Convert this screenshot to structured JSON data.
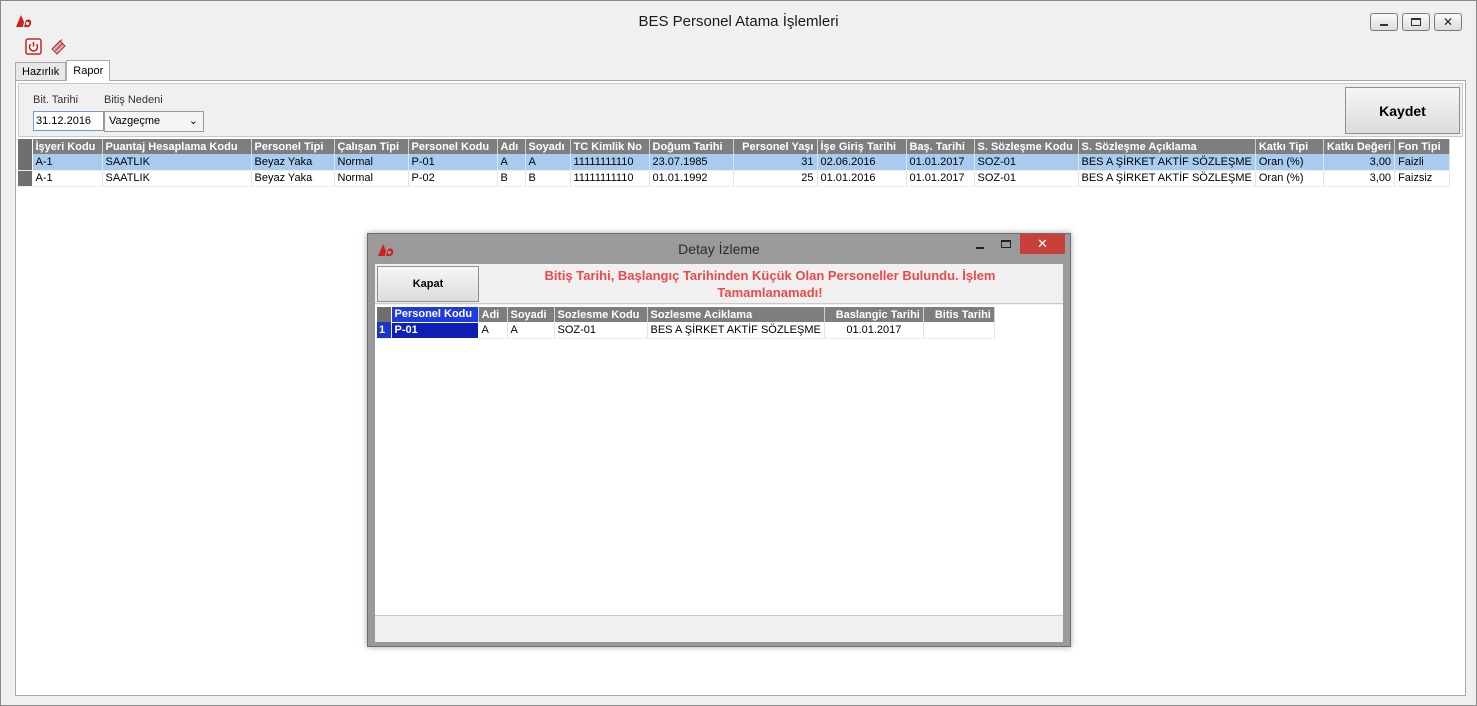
{
  "window": {
    "title": "BES Personel Atama İşlemleri"
  },
  "tabs": [
    {
      "label": "Hazırlık",
      "active": false
    },
    {
      "label": "Rapor",
      "active": true
    }
  ],
  "filters": {
    "end_date_label": "Bit. Tarihi",
    "end_date_value": "31.12.2016",
    "reason_label": "Bitiş Nedeni",
    "reason_value": "Vazgeçme"
  },
  "save_label": "Kaydet",
  "main_grid": {
    "columns": [
      "İşyeri Kodu",
      "Puantaj Hesaplama Kodu",
      "Personel Tipi",
      "Çalışan Tipi",
      "Personel Kodu",
      "Adı",
      "Soyadı",
      "TC Kimlik No",
      "Doğum Tarihi",
      "Personel Yaşı",
      "İşe Giriş Tarihi",
      "Baş. Tarihi",
      "S. Sözleşme Kodu",
      "S. Sözleşme Açıklama",
      "Katkı Tipi",
      "Katkı Değeri",
      "Fon Tipi"
    ],
    "rows": [
      [
        "A-1",
        "SAATLIK",
        "Beyaz Yaka",
        "Normal",
        "P-01",
        "A",
        "A",
        "11111111110",
        "23.07.1985",
        "31",
        "02.06.2016",
        "01.01.2017",
        "SOZ-01",
        "BES A ŞİRKET AKTİF SÖZLEŞME",
        "Oran (%)",
        "3,00",
        "Faizli"
      ],
      [
        "A-1",
        "SAATLIK",
        "Beyaz Yaka",
        "Normal",
        "P-02",
        "B",
        "B",
        "11111111110",
        "01.01.1992",
        "25",
        "01.01.2016",
        "01.01.2017",
        "SOZ-01",
        "BES A ŞİRKET AKTİF SÖZLEŞME",
        "Oran (%)",
        "3,00",
        "Faizsiz"
      ]
    ]
  },
  "dialog": {
    "title": "Detay İzleme",
    "close_label": "Kapat",
    "message": "Bitiş Tarihi, Başlangıç Tarihinden Küçük Olan Personeller Bulundu. İşlem Tamamlanamadı!",
    "columns": [
      "Personel Kodu",
      "Adi",
      "Soyadi",
      "Sozlesme Kodu",
      "Sozlesme Aciklama",
      "Baslangic Tarihi",
      "Bitis Tarihi"
    ],
    "rows": [
      {
        "num": "1",
        "cells": [
          "P-01",
          "A",
          "A",
          "SOZ-01",
          "BES A ŞİRKET AKTİF SÖZLEŞME",
          "01.01.2017",
          ""
        ]
      }
    ]
  },
  "colors": {
    "selected_row": "#a9cbef",
    "grid_header": "#7e7e7e",
    "error_text": "#ec4a4a",
    "dialog_close": "#c7403a",
    "focus_blue": "#0d1fb4"
  }
}
